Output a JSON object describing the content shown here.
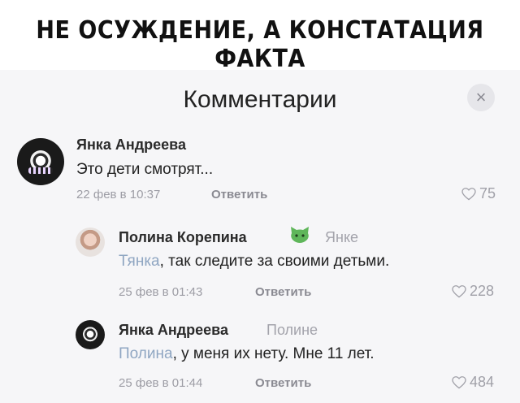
{
  "caption": "НЕ ОСУЖДЕНИЕ, А КОНСТАТАЦИЯ ФАКТА",
  "header": {
    "title": "Комментарии",
    "close_symbol": "×"
  },
  "comments": [
    {
      "author": "Янка Андреева",
      "text": "Это дети смотрят...",
      "date": "22 фев в 10:37",
      "reply_label": "Ответить",
      "likes": "75"
    },
    {
      "author": "Полина Корепина",
      "reply_to": "Янке",
      "mention": "Тянка",
      "text": ", так следите за своими детьми.",
      "date": "25 фев в 01:43",
      "reply_label": "Ответить",
      "likes": "228"
    },
    {
      "author": "Янка Андреева",
      "reply_to": "Полине",
      "mention": "Полина",
      "text": ", у меня их нету. Мне 11 лет.",
      "date": "25 фев в 01:44",
      "reply_label": "Ответить",
      "likes": "484"
    }
  ],
  "colors": {
    "panel": "#f6f6f8",
    "mention": "#8fa6c2",
    "meta": "#9d9da5"
  },
  "icons": [
    "close-icon",
    "heart-icon",
    "cat-emoji-icon"
  ]
}
